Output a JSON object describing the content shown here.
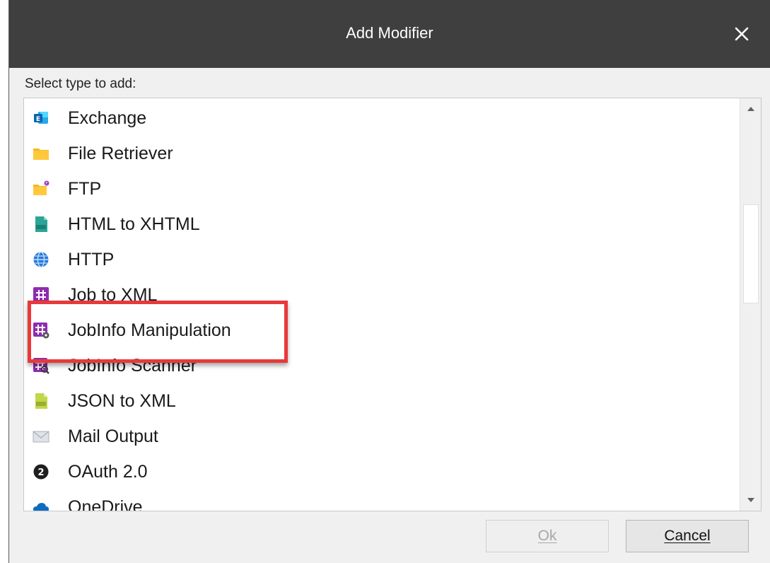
{
  "dialog": {
    "title": "Add Modifier",
    "close_icon": "close-icon"
  },
  "prompt": "Select type to add:",
  "items": [
    {
      "label": "Exchange",
      "icon": "exchange-icon"
    },
    {
      "label": "File Retriever",
      "icon": "folder-icon"
    },
    {
      "label": "FTP",
      "icon": "ftp-folder-icon"
    },
    {
      "label": "HTML to XHTML",
      "icon": "html-file-icon"
    },
    {
      "label": "HTTP",
      "icon": "globe-icon"
    },
    {
      "label": "Job to XML",
      "icon": "hash-icon"
    },
    {
      "label": "JobInfo Manipulation",
      "icon": "hash-gear-icon"
    },
    {
      "label": "JobInfo Scanner",
      "icon": "hash-search-icon"
    },
    {
      "label": "JSON to XML",
      "icon": "json-file-icon"
    },
    {
      "label": "Mail Output",
      "icon": "mail-icon"
    },
    {
      "label": "OAuth 2.0",
      "icon": "oauth-icon"
    },
    {
      "label": "OneDrive",
      "icon": "onedrive-icon"
    }
  ],
  "highlighted_item": "JobInfo Manipulation",
  "buttons": {
    "ok": "Ok",
    "cancel": "Cancel"
  },
  "colors": {
    "titlebar": "#3f3f3f",
    "highlight": "#e8393a",
    "folder": "#f5b81c",
    "purple": "#8e2cae"
  }
}
